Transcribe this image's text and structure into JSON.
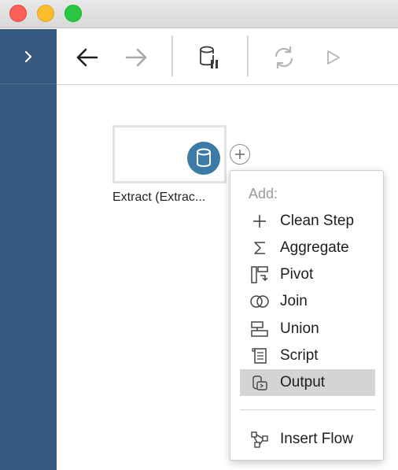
{
  "window": {
    "controls": [
      "close",
      "minimize",
      "maximize"
    ],
    "colors": {
      "close": "#fc5f57",
      "minimize": "#fdbc2e",
      "maximize": "#28c840"
    }
  },
  "sidebar": {
    "toggle_icon": "chevron-right-icon",
    "color": "#35587f"
  },
  "toolbar": {
    "buttons": [
      {
        "name": "back",
        "icon": "arrow-left-icon",
        "enabled": true
      },
      {
        "name": "forward",
        "icon": "arrow-right-icon",
        "enabled": false
      },
      {
        "name": "pause-updates",
        "icon": "database-pause-icon",
        "enabled": true
      },
      {
        "name": "refresh",
        "icon": "refresh-icon",
        "enabled": false
      },
      {
        "name": "run",
        "icon": "play-icon",
        "enabled": false
      }
    ]
  },
  "flow": {
    "node": {
      "label": "Extract (Extrac...",
      "icon": "database-icon",
      "icon_color": "#3d7aa6"
    },
    "add_button_icon": "plus-circle-icon"
  },
  "menu": {
    "header": "Add:",
    "items": [
      {
        "label": "Clean Step",
        "icon": "plus-icon"
      },
      {
        "label": "Aggregate",
        "icon": "sigma-icon"
      },
      {
        "label": "Pivot",
        "icon": "pivot-icon"
      },
      {
        "label": "Join",
        "icon": "join-icon"
      },
      {
        "label": "Union",
        "icon": "union-icon"
      },
      {
        "label": "Script",
        "icon": "script-icon"
      },
      {
        "label": "Output",
        "icon": "output-icon",
        "selected": true
      }
    ],
    "footer_items": [
      {
        "label": "Insert Flow",
        "icon": "insert-flow-icon"
      }
    ]
  }
}
